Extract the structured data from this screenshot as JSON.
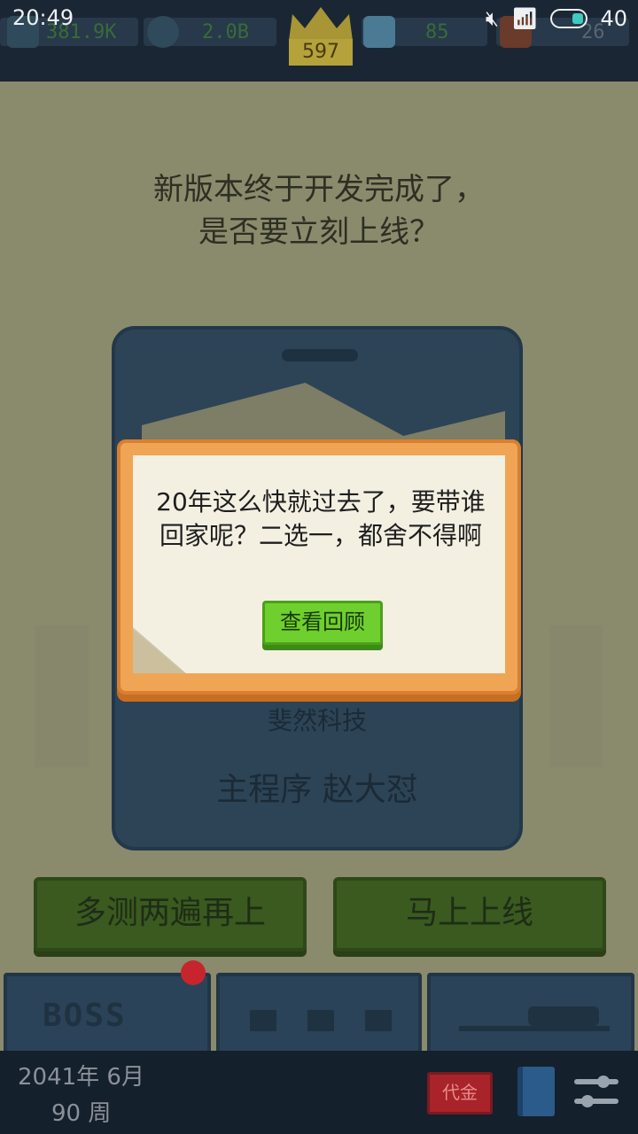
{
  "status_bar": {
    "time": "20:49",
    "battery": "40"
  },
  "resources": {
    "money": "381.9K",
    "fans": "2.0B",
    "level": "597",
    "staff": "85",
    "items": "26"
  },
  "question": {
    "line1": "新版本终于开发完成了，",
    "line2": "是否要立刻上线？"
  },
  "card": {
    "company": "斐然科技",
    "person": "主程序 赵大怼"
  },
  "choices": {
    "left": "多测两遍再上",
    "right": "马上上线"
  },
  "tabs": {
    "boss": "BOSS"
  },
  "footer": {
    "date": "2041年 6月",
    "week": "90 周",
    "gold_label": "代金"
  },
  "dialog": {
    "message": "20年这么快就过去了，要带谁回家呢？二选一，都舍不得啊",
    "button": "查看回顾"
  },
  "colors": {
    "dialog_border": "#f0a554",
    "review_button": "#6fcf2e",
    "choice_button": "#3a5a20"
  }
}
